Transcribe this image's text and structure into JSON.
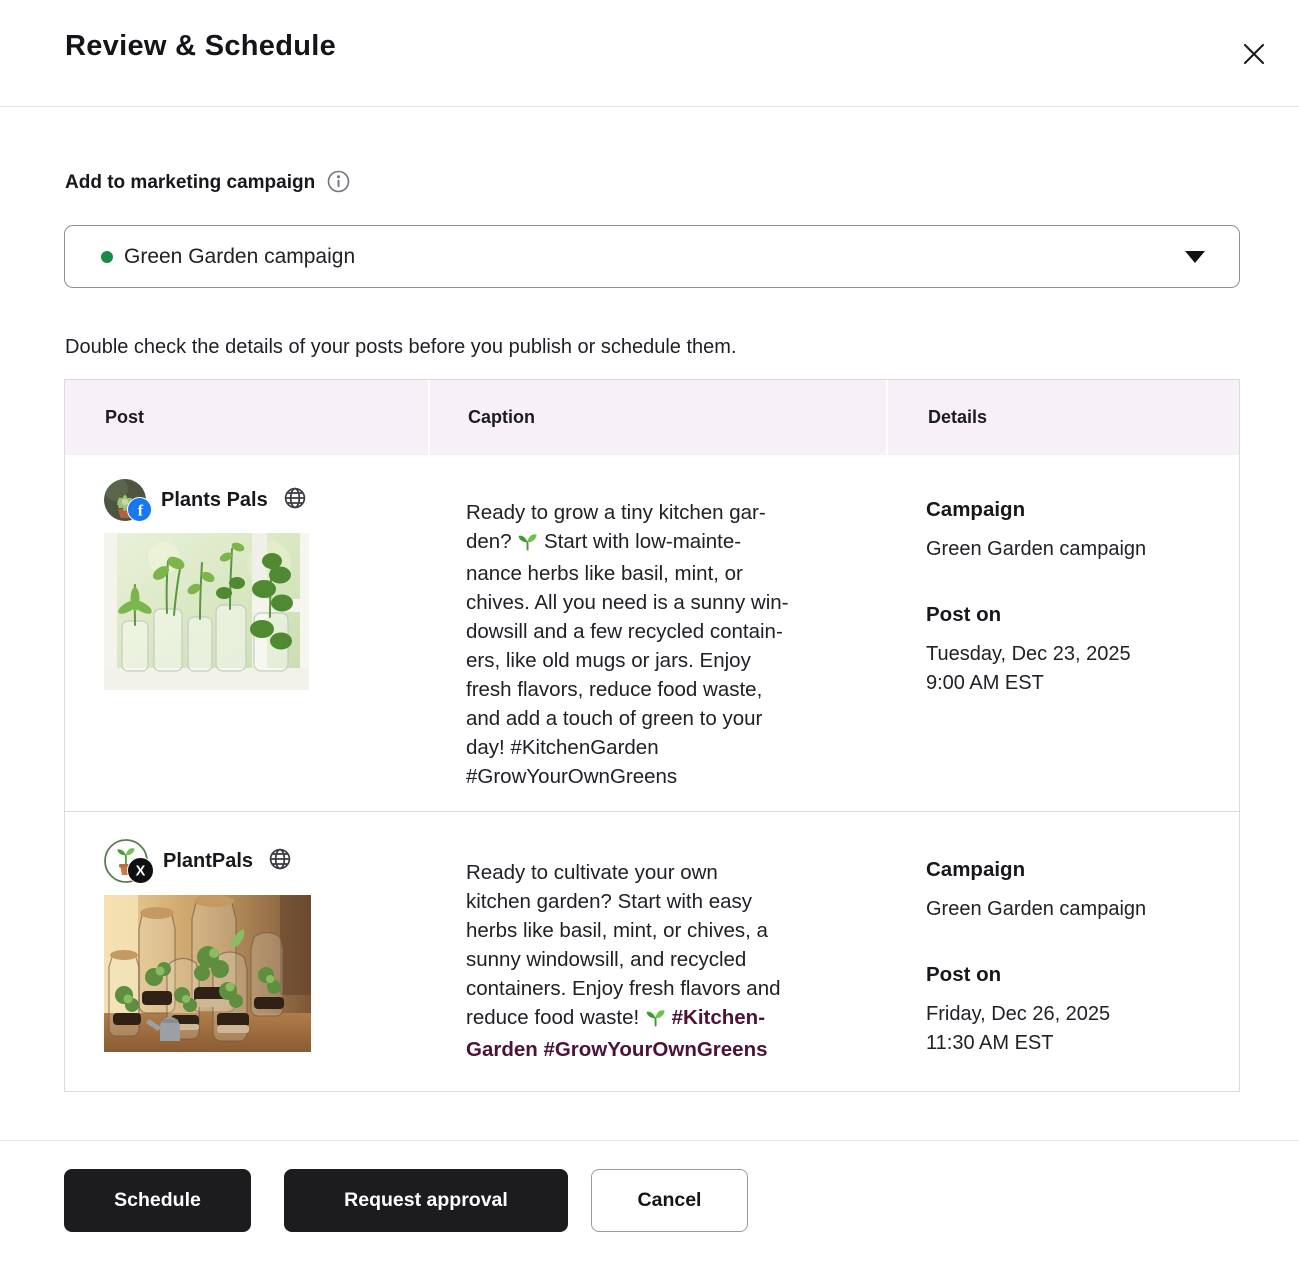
{
  "modal": {
    "title": "Review & Schedule"
  },
  "campaign": {
    "label": "Add to marketing campaign",
    "selected": "Green Garden campaign"
  },
  "instruction": "Double check the details of your posts before you publish or schedule them.",
  "table": {
    "headers": [
      "Post",
      "Caption",
      "Details"
    ],
    "rows": [
      {
        "account": "Plants Pals",
        "network": "Facebook",
        "caption_before": "Ready to grow a tiny kitchen gar-\nden? ",
        "caption_after": " Start with low-mainte-\nnance herbs like basil, mint, or\nchives. All you need is a sunny win-\ndowsill and a few recycled contain-\ners, like old mugs or jars. Enjoy\nfresh flavors, reduce food waste,\nand add a touch of green to your\nday! #KitchenGarden\n#GrowYourOwnGreens",
        "hashtags": "",
        "details": {
          "campaign_label": "Campaign",
          "campaign_value": "Green Garden campaign",
          "post_on_label": "Post on",
          "post_date": "Tuesday, Dec 23, 2025",
          "post_time": "9:00 AM EST"
        }
      },
      {
        "account": "PlantPals",
        "network": "X",
        "caption_before": "Ready to cultivate your own\nkitchen garden? Start with easy\nherbs like basil, mint, or chives, a\nsunny windowsill, and recycled\ncontainers. Enjoy fresh flavors and\nreduce food waste! ",
        "caption_after": "",
        "hashtags": "#Kitchen-\nGarden #GrowYourOwnGreens",
        "details": {
          "campaign_label": "Campaign",
          "campaign_value": "Green Garden campaign",
          "post_on_label": "Post on",
          "post_date": "Friday, Dec 26, 2025",
          "post_time": "11:30 AM EST"
        }
      }
    ]
  },
  "footer": {
    "schedule_label": "Schedule",
    "request_approval_label": "Request approval",
    "cancel_label": "Cancel"
  },
  "icons": {
    "close": "x-icon",
    "info": "info-icon",
    "globe": "globe-icon",
    "caret": "chevron-down-icon",
    "seedling": "seedling-emoji",
    "facebook_badge_letter": "f",
    "x_badge_letter": "X"
  },
  "colors": {
    "status_green": "#1a8a4a",
    "hashtag_purple": "#4d1238",
    "table_header_bg": "#f7f1f7",
    "button_dark": "#1c1c1f",
    "facebook_blue": "#1877f2"
  }
}
